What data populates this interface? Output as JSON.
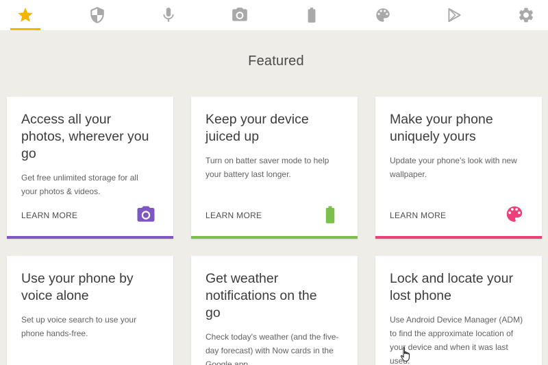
{
  "tabs": [
    {
      "icon": "star-icon",
      "active": true
    },
    {
      "icon": "shield-icon"
    },
    {
      "icon": "microphone-icon"
    },
    {
      "icon": "camera-icon"
    },
    {
      "icon": "battery-icon"
    },
    {
      "icon": "palette-icon"
    },
    {
      "icon": "play-store-icon"
    },
    {
      "icon": "gear-icon"
    }
  ],
  "colors": {
    "active_tab": "#f4b400",
    "inactive_tab": "#a9a9a9",
    "photos": "#7e57c2",
    "battery": "#7cc04b",
    "wallpaper": "#ec407a"
  },
  "section_title": "Featured",
  "cards": [
    {
      "title_lines": [
        "Access all your",
        "photos, wherever you",
        "go"
      ],
      "desc_lines": [
        "Get free unlimited storage for all",
        "your photos & videos."
      ],
      "learn_more": "LEARN MORE",
      "icon": "camera-icon",
      "accent": "#7e57c2"
    },
    {
      "title_lines": [
        "Keep your device",
        "juiced up"
      ],
      "desc_lines": [
        "Turn on batter saver mode to help",
        "your battery last longer."
      ],
      "learn_more": "LEARN MORE",
      "icon": "battery-icon",
      "accent": "#7cc04b"
    },
    {
      "title_lines": [
        "Make your phone",
        "uniquely yours"
      ],
      "desc_lines": [
        "Update your phone's look with new",
        "wallpaper."
      ],
      "learn_more": "LEARN MORE",
      "icon": "palette-icon",
      "accent": "#ec407a"
    },
    {
      "title_lines": [
        "Use your phone by",
        "voice alone"
      ],
      "desc_lines": [
        "Set up voice search to use your",
        "phone hands-free."
      ]
    },
    {
      "title_lines": [
        "Get weather",
        "notifications on the",
        "go"
      ],
      "desc_lines": [
        "Check today's weather (and the five-",
        "day forecast) with Now cards in the",
        "Google app."
      ]
    },
    {
      "title_lines": [
        "Lock and locate your",
        "lost phone"
      ],
      "desc_lines": [
        "Use Android Device Manager (ADM)",
        "to find the approximate location of",
        "your device and when it was last",
        "used."
      ]
    }
  ]
}
